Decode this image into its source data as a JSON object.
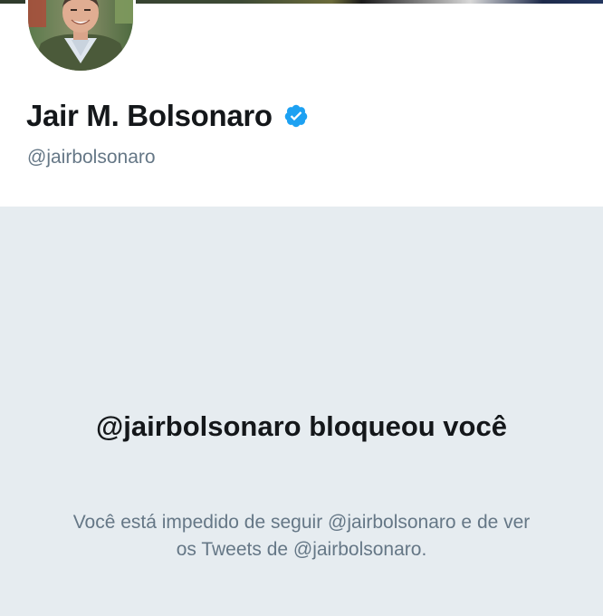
{
  "profile": {
    "display_name": "Jair M. Bolsonaro",
    "handle": "@jairbolsonaro",
    "verified": true,
    "verified_icon": "verified-badge-icon",
    "avatar_icon": "profile-photo"
  },
  "blocked": {
    "title": "@jairbolsonaro bloqueou você",
    "description": "Você está impedido de seguir @jairbolsonaro e de ver os Tweets de @jairbolsonaro."
  },
  "colors": {
    "accent": "#1da1f2",
    "text_primary": "#14171a",
    "text_secondary": "#657786",
    "background": "#e6ecf0"
  }
}
